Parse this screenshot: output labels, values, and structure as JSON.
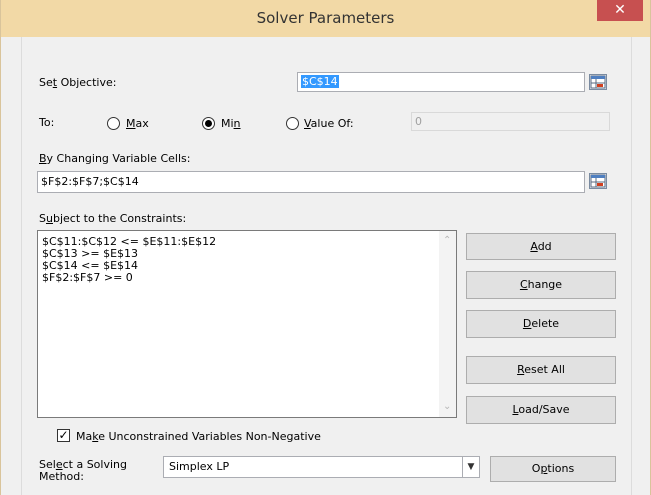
{
  "window": {
    "title": "Solver Parameters",
    "close_label": "✕"
  },
  "objective": {
    "label": "Set Objective:",
    "value": "$C$14"
  },
  "to": {
    "label": "To:",
    "max_label": "Max",
    "min_label": "Min",
    "value_of_label": "Value Of:",
    "value_of_value": "0",
    "selected": "Min"
  },
  "changing_cells": {
    "label": "By Changing Variable Cells:",
    "value": "$F$2:$F$7;$C$14"
  },
  "constraints": {
    "label": "Subject to the Constraints:",
    "items": [
      "$C$11:$C$12 <= $E$11:$E$12",
      "$C$13 >= $E$13",
      "$C$14 <= $E$14",
      "$F$2:$F$7 >= 0"
    ]
  },
  "buttons": {
    "add": "Add",
    "change": "Change",
    "delete": "Delete",
    "reset_all": "Reset All",
    "load_save": "Load/Save",
    "options": "Options"
  },
  "nonnegative": {
    "label": "Make Unconstrained Variables Non-Negative",
    "checked": true
  },
  "method": {
    "label_line1": "Select a Solving",
    "label_line2": "Method:",
    "value": "Simplex LP"
  },
  "icons": {
    "range_picker": "range-picker-icon",
    "close": "close-icon"
  }
}
